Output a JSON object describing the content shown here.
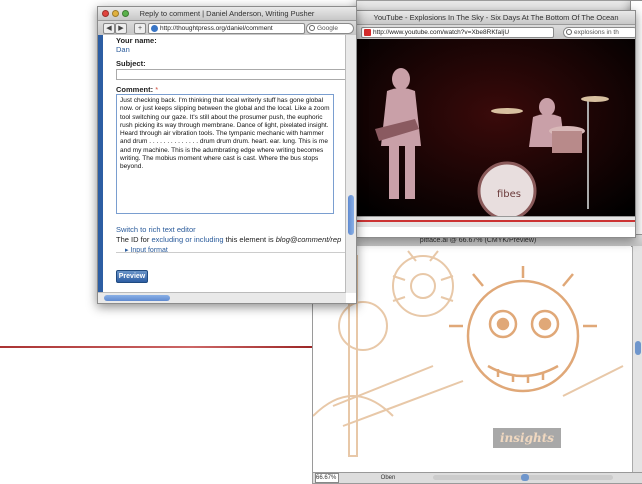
{
  "comment_window": {
    "title": "Reply to comment | Daniel Anderson, Writing Pusher",
    "url": "http://thoughtpress.org/daniel/comment",
    "search_placeholder": "Google",
    "form": {
      "name_label": "Your name:",
      "name_value": "Dan",
      "subject_label": "Subject:",
      "comment_label": "Comment:",
      "required_marker": "*",
      "comment_text": "Just checking back. I'm thinking that local writerly stuff has gone global now. or just keeps slipping between the global and the local. Like a zoom tool switching our gaze. It's still about the prosumer push, the euphoric rush picking its way through membrane. Dance of light, pixelated insight. Heard through air vibration tools. The tympanic mechanic with hammer and drum . . . . . . . . . . . . . . drum drum drum. heart. ear. lung. This is me and my machine. This is the adumbrating edge where writing becomes writing. The mobius moment where cast is cast. Where the bus stops beyond.",
      "rich_text_link": "Switch to rich text editor",
      "id_text_prefix": "The ID for",
      "id_link_excluding": "excluding or including",
      "id_text_middle": "this element is",
      "id_value": "blog@comment/rep",
      "input_format": "Input format",
      "preview_button": "Preview"
    }
  },
  "youtube_window": {
    "title": "YouTube - Explosions In The Sky - Six Days At The Bottom Of The Ocean",
    "url": "http://www.youtube.com/watch?v=Xbe8RKfaIjU",
    "search_value": "explosions in th"
  },
  "illustrator_window": {
    "title": "pitface.ai @ 66.67% (CMYK/Preview)",
    "zoom": "66.67%",
    "status_mode": "Oben",
    "artwork_text": "insights"
  },
  "colors": {
    "drupal_blue": "#2d5ea3",
    "artwork_orange": "#e8b888",
    "stage_red": "#5a1010"
  }
}
